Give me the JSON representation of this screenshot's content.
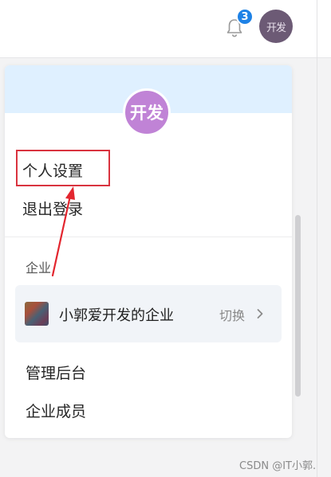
{
  "header": {
    "notification_count": "3",
    "user_avatar_text": "开发"
  },
  "panel": {
    "avatar_text": "开发",
    "menu": {
      "personal_settings": "个人设置",
      "logout": "退出登录"
    },
    "enterprise": {
      "section_label": "企业",
      "company_name": "小郭爱开发的企业",
      "switch_label": "切换"
    },
    "admin": {
      "management_backend": "管理后台",
      "members": "企业成员"
    }
  },
  "watermark": "CSDN @IT小郭.",
  "colors": {
    "badge": "#1e82e6",
    "panel_avatar": "#c083d6",
    "panel_header": "#dff0ff",
    "annotation_red": "#d9333f"
  }
}
